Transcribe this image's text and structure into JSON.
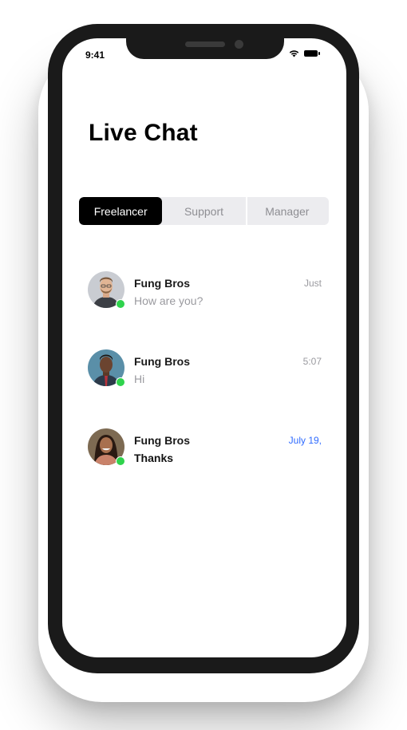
{
  "status_bar": {
    "time": "9:41",
    "icons": [
      "wifi-icon",
      "battery-icon"
    ]
  },
  "title": "Live Chat",
  "tabs": [
    {
      "label": "Freelancer",
      "active": true
    },
    {
      "label": "Support",
      "active": false
    },
    {
      "label": "Manager",
      "active": false
    }
  ],
  "chats": [
    {
      "name": "Fung Bros",
      "message": "How are you?",
      "time": "Just",
      "online": true,
      "unread": false
    },
    {
      "name": "Fung Bros",
      "message": "Hi",
      "time": "5:07",
      "online": true,
      "unread": false
    },
    {
      "name": "Fung Bros",
      "message": "Thanks",
      "time": "July 19,",
      "online": true,
      "unread": true
    }
  ],
  "colors": {
    "accent": "#2f6bff",
    "online": "#2fd34d",
    "active_tab": "#000000"
  }
}
